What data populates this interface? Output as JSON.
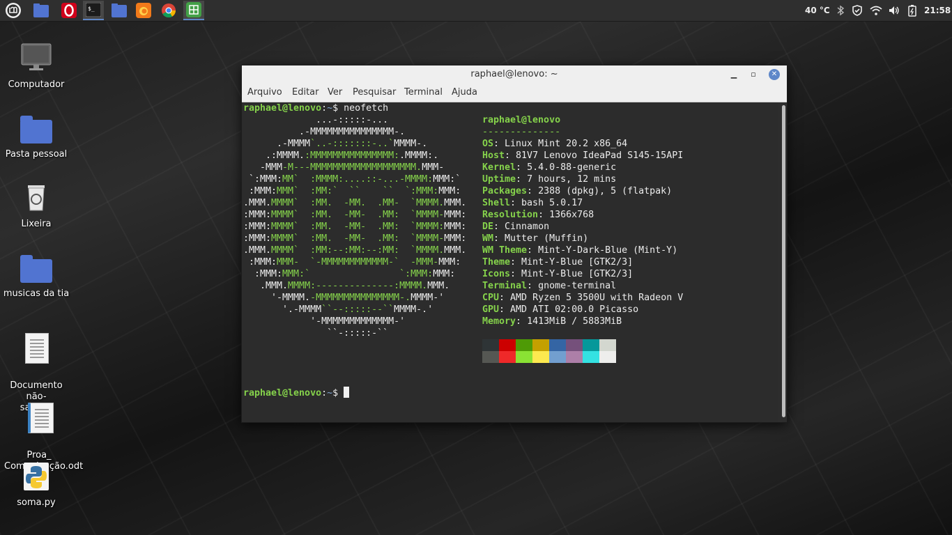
{
  "panel": {
    "clock": "21:58",
    "temperature": "40 °C",
    "launchers": [
      "mint-menu",
      "files",
      "opera",
      "terminal",
      "folder",
      "firefox",
      "chrome",
      "calc"
    ]
  },
  "desktop": {
    "icons": [
      {
        "label": "Computador"
      },
      {
        "label": "Pasta pessoal"
      },
      {
        "label": "Lixeira"
      },
      {
        "label": "musicas da tia"
      },
      {
        "label": "Documento não-\nsalvo 1"
      },
      {
        "label": "Proa_\nComunicação.odt"
      },
      {
        "label": "soma.py"
      }
    ]
  },
  "terminal": {
    "title": "raphael@lenovo: ~",
    "menu": [
      "Arquivo",
      "Editar",
      "Ver",
      "Pesquisar",
      "Terminal",
      "Ajuda"
    ],
    "prompt_user": "raphael@lenovo",
    "prompt_path": "~",
    "prompt_symbol": "$",
    "command": "neofetch",
    "info_header": "raphael@lenovo",
    "separator": "--------------",
    "info": [
      {
        "key": "OS",
        "value": "Linux Mint 20.2 x86_64"
      },
      {
        "key": "Host",
        "value": "81V7 Lenovo IdeaPad S145-15API"
      },
      {
        "key": "Kernel",
        "value": "5.4.0-88-generic"
      },
      {
        "key": "Uptime",
        "value": "7 hours, 12 mins"
      },
      {
        "key": "Packages",
        "value": "2388 (dpkg), 5 (flatpak)"
      },
      {
        "key": "Shell",
        "value": "bash 5.0.17"
      },
      {
        "key": "Resolution",
        "value": "1366x768"
      },
      {
        "key": "DE",
        "value": "Cinnamon"
      },
      {
        "key": "WM",
        "value": "Mutter (Muffin)"
      },
      {
        "key": "WM Theme",
        "value": "Mint-Y-Dark-Blue (Mint-Y)"
      },
      {
        "key": "Theme",
        "value": "Mint-Y-Blue [GTK2/3]"
      },
      {
        "key": "Icons",
        "value": "Mint-Y-Blue [GTK2/3]"
      },
      {
        "key": "Terminal",
        "value": "gnome-terminal"
      },
      {
        "key": "CPU",
        "value": "AMD Ryzen 5 3500U with Radeon V"
      },
      {
        "key": "GPU",
        "value": "AMD ATI 02:00.0 Picasso"
      },
      {
        "key": "Memory",
        "value": "1413MiB / 5883MiB"
      }
    ],
    "ascii_logo": [
      [
        [
          "w",
          "             ...-:::::-..."
        ]
      ],
      [
        [
          "w",
          "          .-MMMMMMMMMMMMMMM-."
        ]
      ],
      [
        [
          "w",
          "      .-MMMM"
        ],
        [
          "g",
          "`..-:::::::-..`"
        ],
        [
          "w",
          "MMMM-."
        ]
      ],
      [
        [
          "w",
          "    .:MMMM."
        ],
        [
          "g",
          ":MMMMMMMMMMMMMMM:"
        ],
        [
          "w",
          ".MMMM:."
        ]
      ],
      [
        [
          "w",
          "   -MMM"
        ],
        [
          "g",
          "-M---MMMMMMMMMMMMMMMMMMM."
        ],
        [
          "w",
          "MMM-"
        ]
      ],
      [
        [
          "w",
          " `:MMM:"
        ],
        [
          "g",
          "MM`  :MMMM:....::-...-MMMM:"
        ],
        [
          "w",
          "MMM:`"
        ]
      ],
      [
        [
          "w",
          " :MMM:"
        ],
        [
          "g",
          "MMM`  :MM:`  ``    ``  `:MMM:"
        ],
        [
          "w",
          "MMM:"
        ]
      ],
      [
        [
          "w",
          ".MMM."
        ],
        [
          "g",
          "MMMM`  :MM.  -MM.  .MM-  `MMMM."
        ],
        [
          "w",
          "MMM."
        ]
      ],
      [
        [
          "w",
          ":MMM:"
        ],
        [
          "g",
          "MMMM`  :MM.  -MM-  .MM:  `MMMM-"
        ],
        [
          "w",
          "MMM:"
        ]
      ],
      [
        [
          "w",
          ":MMM:"
        ],
        [
          "g",
          "MMMM`  :MM.  -MM-  .MM:  `MMMM:"
        ],
        [
          "w",
          "MMM:"
        ]
      ],
      [
        [
          "w",
          ":MMM:"
        ],
        [
          "g",
          "MMMM`  :MM.  -MM-  .MM:  `MMMM-"
        ],
        [
          "w",
          "MMM:"
        ]
      ],
      [
        [
          "w",
          ".MMM."
        ],
        [
          "g",
          "MMMM`  :MM:--:MM:--:MM:  `MMMM."
        ],
        [
          "w",
          "MMM."
        ]
      ],
      [
        [
          "w",
          " :MMM:"
        ],
        [
          "g",
          "MMM-  `-MMMMMMMMMMMM-`  -MMM-"
        ],
        [
          "w",
          "MMM:"
        ]
      ],
      [
        [
          "w",
          "  :MMM:"
        ],
        [
          "g",
          "MMM:`                `:MMM:"
        ],
        [
          "w",
          "MMM:"
        ]
      ],
      [
        [
          "w",
          "   .MMM."
        ],
        [
          "g",
          "MMMM:--------------:MMMM."
        ],
        [
          "w",
          "MMM."
        ]
      ],
      [
        [
          "w",
          "     '-MMMM."
        ],
        [
          "g",
          "-MMMMMMMMMMMMMMM-."
        ],
        [
          "w",
          "MMMM-'"
        ]
      ],
      [
        [
          "w",
          "       '.-MMMM"
        ],
        [
          "g",
          "``--:::::--``"
        ],
        [
          "w",
          "MMMM-.'"
        ]
      ],
      [
        [
          "w",
          "            '-MMMMMMMMMMMMM-'"
        ]
      ],
      [
        [
          "w",
          "               ``-:::::-``"
        ]
      ]
    ],
    "palette_dark": [
      "#2e3436",
      "#cc0000",
      "#4e9a06",
      "#c4a000",
      "#3465a4",
      "#75507b",
      "#06989a",
      "#d3d7cf"
    ],
    "palette_light": [
      "#555753",
      "#ef2929",
      "#8ae234",
      "#fce94f",
      "#729fcf",
      "#ad7fa8",
      "#34e2e2",
      "#eeeeec"
    ]
  }
}
